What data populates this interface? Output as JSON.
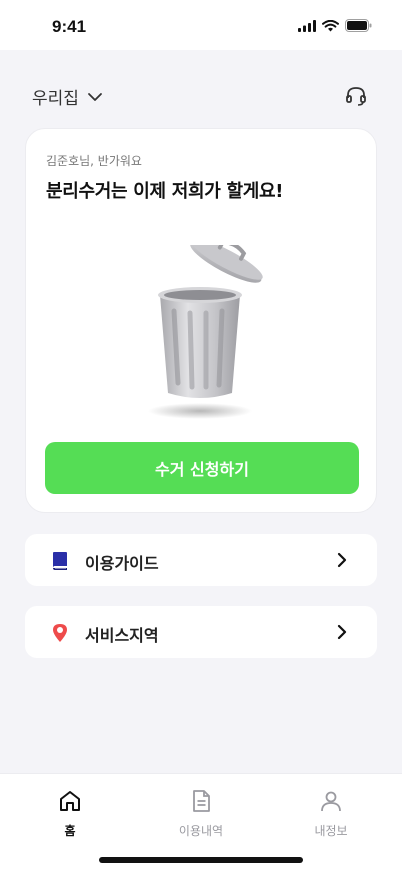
{
  "status_bar": {
    "time": "9:41",
    "icons": [
      "cellular-signal-icon",
      "wifi-icon",
      "battery-icon"
    ]
  },
  "header": {
    "location": "우리집",
    "location_icon": "chevron-down-icon",
    "support_icon": "headset-icon"
  },
  "hero": {
    "greeting": "김준호님, 반가워요",
    "headline": "분리수거는 이제 저희가 할게요!",
    "illustration": "trash-can-icon",
    "cta_label": "수거 신청하기",
    "cta_color": "#55dd55"
  },
  "menu": [
    {
      "label": "이용가이드",
      "icon": "book-icon",
      "icon_color": "#2a2fa8"
    },
    {
      "label": "서비스지역",
      "icon": "map-pin-icon",
      "icon_color": "#ee4b4b"
    }
  ],
  "tabs": [
    {
      "label": "홈",
      "icon": "home-icon",
      "active": true
    },
    {
      "label": "이용내역",
      "icon": "document-icon",
      "active": false
    },
    {
      "label": "내정보",
      "icon": "person-icon",
      "active": false
    }
  ]
}
